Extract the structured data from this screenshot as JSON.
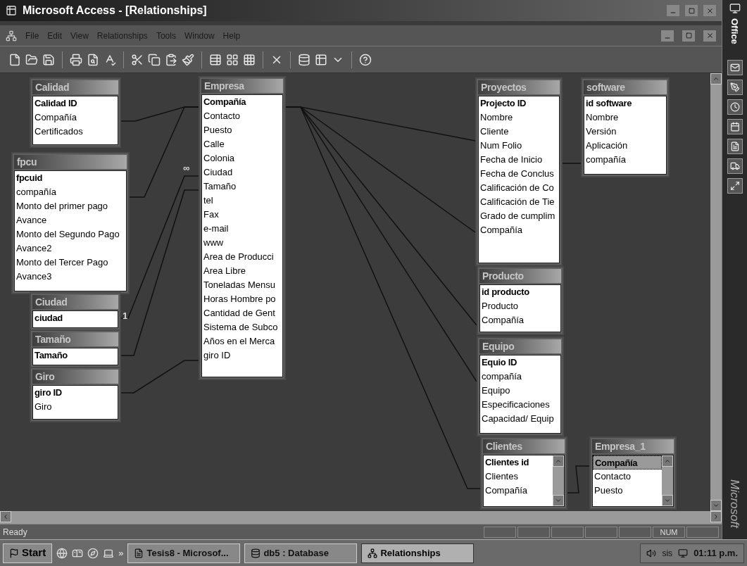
{
  "window": {
    "title": "Microsoft Access - [Relationships]"
  },
  "menu": [
    "File",
    "Edit",
    "View",
    "Relationships",
    "Tools",
    "Window",
    "Help"
  ],
  "tables": [
    {
      "name": "Calidad",
      "scrollbar": false,
      "fields": [
        {
          "name": "Calidad ID",
          "key": true
        },
        {
          "name": "Compañía",
          "key": false
        },
        {
          "name": "Certificados",
          "key": false
        }
      ]
    },
    {
      "name": "fpcu",
      "scrollbar": false,
      "fields": [
        {
          "name": "fpcuid",
          "key": true
        },
        {
          "name": "compañía",
          "key": false
        },
        {
          "name": "Monto del primer pago",
          "key": false
        },
        {
          "name": "Avance",
          "key": false
        },
        {
          "name": "Monto del Segundo Pago",
          "key": false
        },
        {
          "name": "Avance2",
          "key": false
        },
        {
          "name": "Monto del Tercer Pago",
          "key": false
        },
        {
          "name": "Avance3",
          "key": false
        }
      ]
    },
    {
      "name": "Ciudad",
      "scrollbar": false,
      "fields": [
        {
          "name": "ciudad",
          "key": true
        }
      ]
    },
    {
      "name": "Tamaño",
      "scrollbar": false,
      "fields": [
        {
          "name": "Tamaño",
          "key": true
        }
      ]
    },
    {
      "name": "Giro",
      "scrollbar": false,
      "fields": [
        {
          "name": "giro ID",
          "key": true
        },
        {
          "name": "Giro",
          "key": false
        }
      ]
    },
    {
      "name": "Empresa",
      "scrollbar": false,
      "fields": [
        {
          "name": "Compañía",
          "key": true
        },
        {
          "name": "Contacto",
          "key": false
        },
        {
          "name": "Puesto",
          "key": false
        },
        {
          "name": "Calle",
          "key": false
        },
        {
          "name": "Colonia",
          "key": false
        },
        {
          "name": "Ciudad",
          "key": false
        },
        {
          "name": "Tamaño",
          "key": false
        },
        {
          "name": "tel",
          "key": false
        },
        {
          "name": "Fax",
          "key": false
        },
        {
          "name": "e-mail",
          "key": false
        },
        {
          "name": "www",
          "key": false
        },
        {
          "name": "Area de Producci",
          "key": false
        },
        {
          "name": "Area Libre",
          "key": false
        },
        {
          "name": "Toneladas Mensu",
          "key": false
        },
        {
          "name": "Horas Hombre po",
          "key": false
        },
        {
          "name": "Cantidad de Gent",
          "key": false
        },
        {
          "name": "Sistema de Subco",
          "key": false
        },
        {
          "name": "Años en el Merca",
          "key": false
        },
        {
          "name": "giro ID",
          "key": false
        }
      ]
    },
    {
      "name": "Proyectos",
      "scrollbar": false,
      "fields": [
        {
          "name": "Projecto ID",
          "key": true
        },
        {
          "name": "Nombre",
          "key": false
        },
        {
          "name": "Cliente",
          "key": false
        },
        {
          "name": "Num  Folio",
          "key": false
        },
        {
          "name": "Fecha de Inicio",
          "key": false
        },
        {
          "name": "Fecha de Conclus",
          "key": false
        },
        {
          "name": "Calificación de Co",
          "key": false
        },
        {
          "name": "Calificación de Tie",
          "key": false
        },
        {
          "name": "Grado de cumplim",
          "key": false
        },
        {
          "name": "Compañía",
          "key": false
        }
      ]
    },
    {
      "name": "software",
      "scrollbar": false,
      "fields": [
        {
          "name": "id software",
          "key": true
        },
        {
          "name": "Nombre",
          "key": false
        },
        {
          "name": "Versión",
          "key": false
        },
        {
          "name": "Aplicación",
          "key": false
        },
        {
          "name": "compañía",
          "key": false
        }
      ]
    },
    {
      "name": "Producto",
      "scrollbar": false,
      "fields": [
        {
          "name": "id producto",
          "key": true
        },
        {
          "name": "Producto",
          "key": false
        },
        {
          "name": "Compañía",
          "key": false
        }
      ]
    },
    {
      "name": "Equipo",
      "scrollbar": false,
      "fields": [
        {
          "name": "Equio ID",
          "key": true
        },
        {
          "name": "compañía",
          "key": false
        },
        {
          "name": "Equipo",
          "key": false
        },
        {
          "name": "Especificaciones",
          "key": false
        },
        {
          "name": "Capacidad/ Equip",
          "key": false
        }
      ]
    },
    {
      "name": "Clientes",
      "scrollbar": true,
      "fields": [
        {
          "name": "Clientes id",
          "key": true
        },
        {
          "name": "Clientes",
          "key": false
        },
        {
          "name": "Compañía",
          "key": false
        }
      ]
    },
    {
      "name": "Empresa_1",
      "scrollbar": true,
      "fields": [
        {
          "name": "Compañía",
          "key": true,
          "selected": true
        },
        {
          "name": "Contacto",
          "key": false,
          "selected": false
        },
        {
          "name": "Puesto",
          "key": false,
          "selected": false
        }
      ]
    }
  ],
  "relationship_marks": [
    "∞",
    "1"
  ],
  "status_bar": {
    "text": "Ready",
    "indicators": [
      "NUM"
    ]
  },
  "taskbar": {
    "start": "Start",
    "more": "»",
    "tasks": [
      {
        "label": "Tesis8 - Microsof...",
        "selected": false
      },
      {
        "label": "db5 : Database",
        "selected": false
      },
      {
        "label": "Relationships",
        "selected": true
      }
    ],
    "tray_text": "sis",
    "clock": "01:11 p.m."
  },
  "office_bar": {
    "title": "Office",
    "brand": "Microsoft"
  }
}
